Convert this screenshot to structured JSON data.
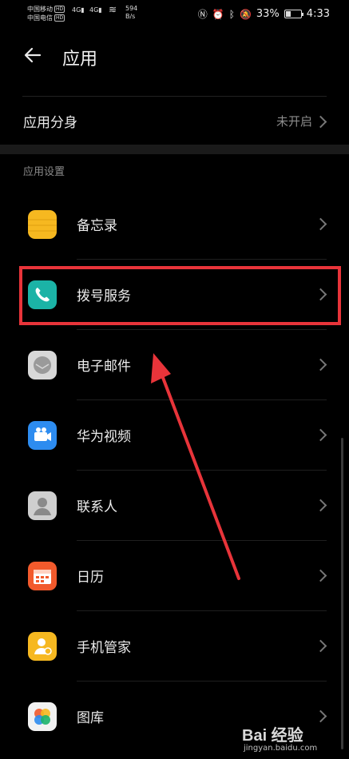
{
  "status_bar": {
    "carrier1": "中国移动",
    "carrier2": "中国电信",
    "hd": "HD",
    "net1": "4G",
    "net2": "4G",
    "speed_value": "594",
    "speed_unit": "B/s",
    "battery_percent": "33%",
    "battery_level": 0.33,
    "time": "4:33"
  },
  "header": {
    "title": "应用"
  },
  "app_twin": {
    "label": "应用分身",
    "value": "未开启"
  },
  "section_title": "应用设置",
  "apps": [
    {
      "label": "备忘录",
      "icon": "notepad-icon",
      "color": "#f6b820"
    },
    {
      "label": "拨号服务",
      "icon": "phone-icon",
      "color": "#1bb3a6"
    },
    {
      "label": "电子邮件",
      "icon": "email-icon",
      "color": "#d8d8d8"
    },
    {
      "label": "华为视频",
      "icon": "video-icon",
      "color": "#2d8cf0"
    },
    {
      "label": "联系人",
      "icon": "contacts-icon",
      "color": "#cfcfcf"
    },
    {
      "label": "日历",
      "icon": "calendar-icon",
      "color": "#f25a2c"
    },
    {
      "label": "手机管家",
      "icon": "phone-manager-icon",
      "color": "#f6b820"
    },
    {
      "label": "图库",
      "icon": "gallery-icon",
      "color": "#f2f2f2"
    }
  ],
  "watermark": {
    "brand": "Bai 经验",
    "url": "jingyan.baidu.com"
  },
  "colors": {
    "background": "#000000",
    "highlight": "#e8343a",
    "accent_arrow": "#e8343a"
  }
}
